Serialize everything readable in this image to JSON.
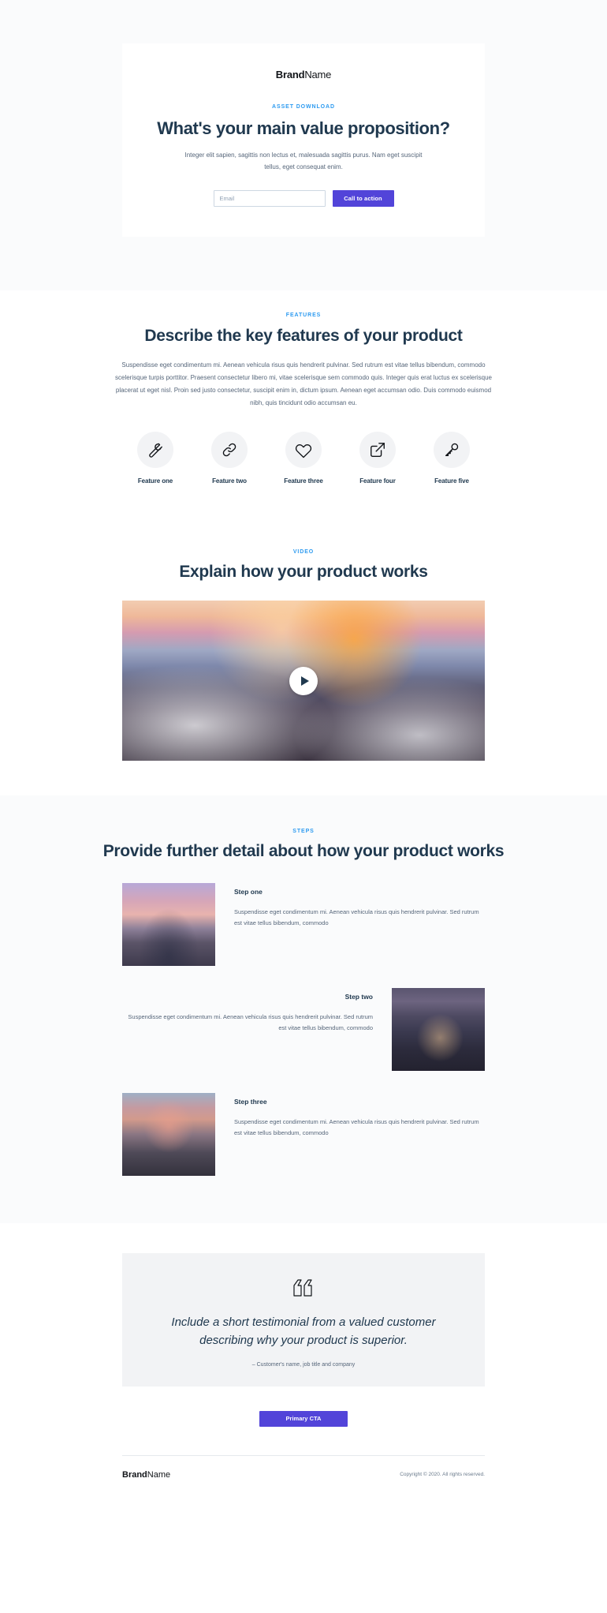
{
  "hero": {
    "brand_bold": "Brand",
    "brand_regular": "Name",
    "eyebrow": "ASSET DOWNLOAD",
    "title": "What's your main value proposition?",
    "subtitle": "Integer elit sapien, sagittis non lectus et, malesuada sagittis purus. Nam eget suscipit tellus, eget consequat enim.",
    "email_placeholder": "Email",
    "email_value": "",
    "cta_label": "Call to action"
  },
  "features": {
    "eyebrow": "FEATURES",
    "title": "Describe the key features of your product",
    "body": "Suspendisse eget condimentum mi. Aenean vehicula risus quis hendrerit pulvinar. Sed rutrum est vitae tellus bibendum, commodo scelerisque turpis porttitor. Praesent consectetur libero mi, vitae scelerisque sem commodo quis. Integer quis erat luctus ex scelerisque placerat ut eget nisl. Proin sed justo consectetur, suscipit enim in, dictum ipsum. Aenean eget accumsan odio. Duis commodo euismod nibh, quis tincidunt odio accumsan eu.",
    "items": [
      {
        "label": "Feature one",
        "icon": "wrench-icon"
      },
      {
        "label": "Feature two",
        "icon": "link-icon"
      },
      {
        "label": "Feature three",
        "icon": "heart-icon"
      },
      {
        "label": "Feature four",
        "icon": "external-link-icon"
      },
      {
        "label": "Feature five",
        "icon": "key-icon"
      }
    ]
  },
  "video": {
    "eyebrow": "VIDEO",
    "title": "Explain how your product works",
    "play_label": "play-button",
    "thumbnail_alt": "mountain-range-at-sunset"
  },
  "steps": {
    "eyebrow": "STEPS",
    "title": "Provide further detail about how your product works",
    "items": [
      {
        "title": "Step one",
        "desc": "Suspendisse eget condimentum mi. Aenean vehicula risus quis hendrerit pulvinar. Sed rutrum est vitae tellus bibendum, commodo",
        "image_alt": "snow-peak-pink-sky",
        "align": "left"
      },
      {
        "title": "Step two",
        "desc": "Suspendisse eget condimentum mi. Aenean vehicula risus quis hendrerit pulvinar. Sed rutrum est vitae tellus bibendum, commodo",
        "image_alt": "matterhorn-night",
        "align": "right"
      },
      {
        "title": "Step three",
        "desc": "Suspendisse eget condimentum mi. Aenean vehicula risus quis hendrerit pulvinar. Sed rutrum est vitae tellus bibendum, commodo",
        "image_alt": "alpenglow-volcano",
        "align": "left"
      }
    ]
  },
  "testimonial": {
    "quote_icon": "quotation-mark-icon",
    "quote": "Include a short testimonial from a valued customer describing why your product is superior.",
    "attribution": "– Customer's name, job title and company"
  },
  "primary_cta": {
    "label": "Primary CTA"
  },
  "footer": {
    "brand_bold": "Brand",
    "brand_regular": "Name",
    "copyright": "Copyright © 2020. All rights reserved."
  },
  "colors": {
    "accent_blue": "#2e9bf0",
    "heading_navy": "#20394f",
    "button_purple": "#5244d9",
    "body_gray": "#56667a",
    "band_gray": "#fafbfc",
    "card_gray": "#f2f3f5"
  }
}
